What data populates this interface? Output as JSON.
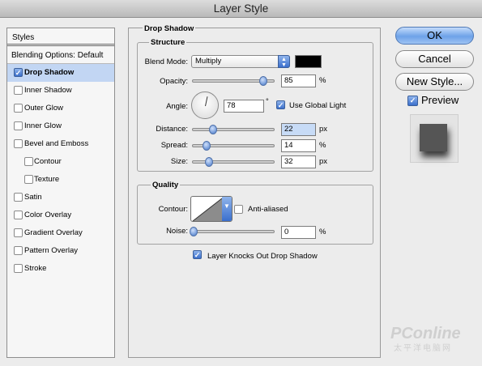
{
  "window": {
    "title": "Layer Style"
  },
  "left_panel": {
    "header": "Styles",
    "blending": "Blending Options: Default",
    "items": [
      {
        "label": "Drop Shadow",
        "checked": true,
        "selected": true,
        "sub": false
      },
      {
        "label": "Inner Shadow",
        "checked": false,
        "selected": false,
        "sub": false
      },
      {
        "label": "Outer Glow",
        "checked": false,
        "selected": false,
        "sub": false
      },
      {
        "label": "Inner Glow",
        "checked": false,
        "selected": false,
        "sub": false
      },
      {
        "label": "Bevel and Emboss",
        "checked": false,
        "selected": false,
        "sub": false
      },
      {
        "label": "Contour",
        "checked": false,
        "selected": false,
        "sub": true
      },
      {
        "label": "Texture",
        "checked": false,
        "selected": false,
        "sub": true
      },
      {
        "label": "Satin",
        "checked": false,
        "selected": false,
        "sub": false
      },
      {
        "label": "Color Overlay",
        "checked": false,
        "selected": false,
        "sub": false
      },
      {
        "label": "Gradient Overlay",
        "checked": false,
        "selected": false,
        "sub": false
      },
      {
        "label": "Pattern Overlay",
        "checked": false,
        "selected": false,
        "sub": false
      },
      {
        "label": "Stroke",
        "checked": false,
        "selected": false,
        "sub": false
      }
    ]
  },
  "drop_shadow": {
    "title": "Drop Shadow",
    "structure": {
      "title": "Structure",
      "blend_mode_label": "Blend Mode:",
      "blend_mode_value": "Multiply",
      "shadow_color": "#000000",
      "opacity_label": "Opacity:",
      "opacity_value": "85",
      "opacity_unit": "%",
      "opacity_fraction": 0.85,
      "angle_label": "Angle:",
      "angle_value": "78",
      "angle_unit": "°",
      "global_light_label": "Use Global Light",
      "global_light_checked": true,
      "distance_label": "Distance:",
      "distance_value": "22",
      "distance_unit": "px",
      "spread_label": "Spread:",
      "spread_value": "14",
      "spread_unit": "%",
      "size_label": "Size:",
      "size_value": "32",
      "size_unit": "px"
    },
    "quality": {
      "title": "Quality",
      "contour_label": "Contour:",
      "anti_aliased_label": "Anti-aliased",
      "anti_aliased_checked": false,
      "noise_label": "Noise:",
      "noise_value": "0",
      "noise_unit": "%"
    },
    "knocks_out_label": "Layer Knocks Out Drop Shadow",
    "knocks_out_checked": true
  },
  "buttons": {
    "ok": "OK",
    "cancel": "Cancel",
    "new_style": "New Style..."
  },
  "preview": {
    "label": "Preview",
    "checked": true
  },
  "watermark": {
    "brand": "PConline",
    "sub": "太平洋电脑网"
  },
  "colors": {
    "accent": "#3a6fcd",
    "selected_row": "#c2d6f3"
  }
}
